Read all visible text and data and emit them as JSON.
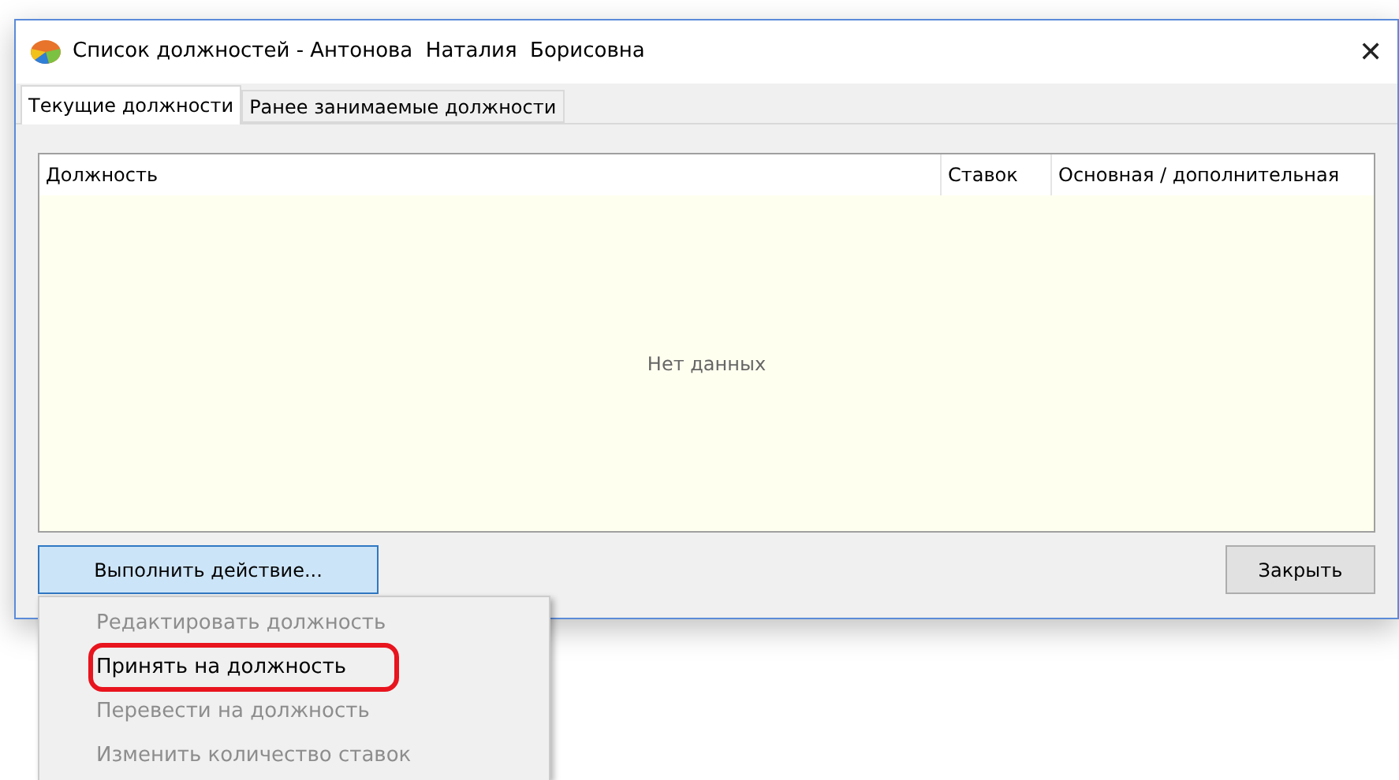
{
  "window": {
    "title": "Список должностей - Антонова  Наталия  Борисовна",
    "close": "✕"
  },
  "tabs": [
    {
      "label": "Текущие должности",
      "selected": true
    },
    {
      "label": "Ранее занимаемые должности",
      "selected": false
    }
  ],
  "table": {
    "columns": [
      "Должность",
      "Ставок",
      "Основная / дополнительная"
    ],
    "empty_text": "Нет данных"
  },
  "buttons": {
    "action": "Выполнить действие...",
    "close": "Закрыть"
  },
  "menu": {
    "items": [
      {
        "label": "Редактировать должность",
        "disabled": true,
        "highlighted": false
      },
      {
        "label": "Принять на должность",
        "disabled": false,
        "highlighted": true
      },
      {
        "label": "Перевести на должность",
        "disabled": true,
        "highlighted": false
      },
      {
        "label": "Изменить количество ставок",
        "disabled": true,
        "highlighted": false
      }
    ]
  }
}
